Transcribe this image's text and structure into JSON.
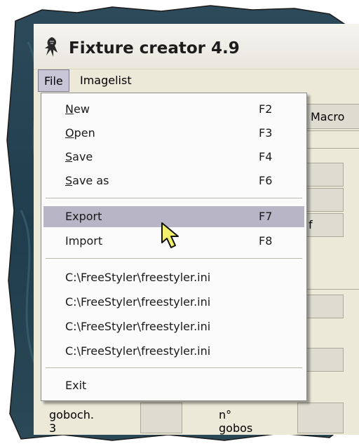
{
  "window": {
    "title": "Fixture creator 4.9"
  },
  "menubar": {
    "items": [
      {
        "label": "File",
        "open": true
      },
      {
        "label": "Imagelist",
        "open": false
      }
    ]
  },
  "file_menu": {
    "items": [
      {
        "label": "New",
        "mnemonic": "N",
        "rest": "ew",
        "shortcut": "F2"
      },
      {
        "label": "Open",
        "mnemonic": "O",
        "rest": "pen",
        "shortcut": "F3"
      },
      {
        "label": "Save",
        "mnemonic": "S",
        "rest": "ave",
        "shortcut": "F4"
      },
      {
        "label": "Save as",
        "mnemonic": "S",
        "rest": "ave as",
        "shortcut": "F6"
      },
      {
        "label": "Export",
        "shortcut": "F7",
        "highlighted": true
      },
      {
        "label": "Import",
        "shortcut": "F8"
      }
    ],
    "recent_files": [
      "C:\\FreeStyler\\freestyler.ini",
      "C:\\FreeStyler\\freestyler.ini",
      "C:\\FreeStyler\\freestyler.ini",
      "C:\\FreeStyler\\freestyler.ini"
    ],
    "exit_label": "Exit"
  },
  "background_form": {
    "tab_partial": "Macro",
    "field_partial": "f",
    "gobo_label": "goboch. 3",
    "gobos_label": "n° gobos"
  },
  "colors": {
    "window_bg": "#ece9d8",
    "menu_bg": "#fbfbfb",
    "highlight": "#b7b5c6",
    "cursor_fill": "#f2ef6a"
  }
}
